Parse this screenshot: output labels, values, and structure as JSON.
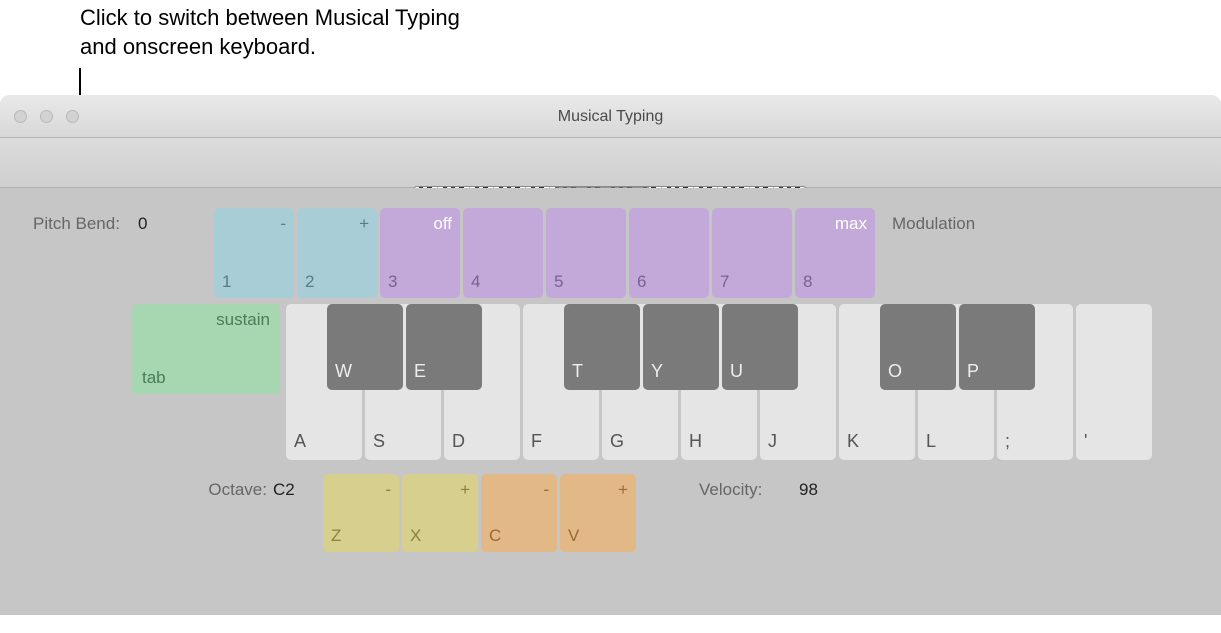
{
  "callout": "Click to switch between Musical Typing and onscreen keyboard.",
  "window_title": "Musical Typing",
  "mode_toggle": {
    "piano_selected": false,
    "typing_selected": true
  },
  "mini_keyboard": {
    "octaves": 7,
    "highlight_start_pct": 36,
    "highlight_width_pct": 24
  },
  "pitch_bend": {
    "label": "Pitch Bend:",
    "value": "0"
  },
  "modulation_label": "Modulation",
  "number_keys": [
    {
      "top": "-",
      "bottom": "1",
      "color": "blue"
    },
    {
      "top": "+",
      "bottom": "2",
      "color": "blue"
    },
    {
      "top": "off",
      "bottom": "3",
      "color": "purple",
      "labeled": true
    },
    {
      "top": "",
      "bottom": "4",
      "color": "purple"
    },
    {
      "top": "",
      "bottom": "5",
      "color": "purple"
    },
    {
      "top": "",
      "bottom": "6",
      "color": "purple"
    },
    {
      "top": "",
      "bottom": "7",
      "color": "purple"
    },
    {
      "top": "max",
      "bottom": "8",
      "color": "purple",
      "labeled": true
    }
  ],
  "sustain_key": {
    "top": "sustain",
    "bottom": "tab"
  },
  "white_keys": [
    "A",
    "S",
    "D",
    "F",
    "G",
    "H",
    "J",
    "K",
    "L",
    ";",
    "'"
  ],
  "black_keys": [
    {
      "label": "W",
      "slot": 1
    },
    {
      "label": "E",
      "slot": 2
    },
    {
      "label": "T",
      "slot": 4
    },
    {
      "label": "Y",
      "slot": 5
    },
    {
      "label": "U",
      "slot": 6
    },
    {
      "label": "O",
      "slot": 8
    },
    {
      "label": "P",
      "slot": 9
    }
  ],
  "octave": {
    "label": "Octave:",
    "value": "C2"
  },
  "octave_keys": [
    {
      "top": "-",
      "bottom": "Z",
      "color": "yellow"
    },
    {
      "top": "+",
      "bottom": "X",
      "color": "yellow"
    },
    {
      "top": "-",
      "bottom": "C",
      "color": "orange"
    },
    {
      "top": "+",
      "bottom": "V",
      "color": "orange"
    }
  ],
  "velocity": {
    "label": "Velocity:",
    "value": "98"
  }
}
